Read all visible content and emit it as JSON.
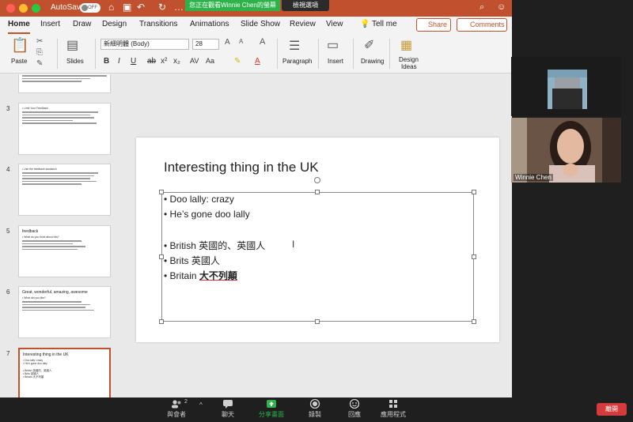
{
  "window": {
    "autosave_label": "AutoSave",
    "autosave_state": "OFF",
    "share_banner": "您正在觀看Winnie Chen的螢幕",
    "view_options": "檢視選項"
  },
  "ribbon_tabs": [
    "Home",
    "Insert",
    "Draw",
    "Design",
    "Transitions",
    "Animations",
    "Slide Show",
    "Review",
    "View",
    "Tell me"
  ],
  "ribbon_buttons": {
    "share": "Share",
    "comments": "Comments",
    "paste": "Paste",
    "slides": "Slides",
    "font_name": "新細明體 (Body)",
    "font_size": "28",
    "paragraph": "Paragraph",
    "insert": "Insert",
    "drawing": "Drawing",
    "design_ideas_1": "Design",
    "design_ideas_2": "Ideas"
  },
  "accent_color": "#c1502e",
  "thumbnails": [
    {
      "num": "",
      "title": "",
      "text": ""
    },
    {
      "num": "3",
      "title": "",
      "text": "• Limit Your Feedback"
    },
    {
      "num": "4",
      "title": "",
      "text": "• Use the feedback sandwich"
    },
    {
      "num": "5",
      "title": "feedback",
      "text": "• What do you think about this?"
    },
    {
      "num": "6",
      "title": "Great, wonderful, amazing, awesome",
      "text": "• What did you like?"
    },
    {
      "num": "7",
      "title": "Interesting thing in the UK",
      "text": "• Doo lally: crazy\n• He's gone doo lally\n\n• British 英國的、英國人\n• Brits 英國人\n• Britain 大不列顛"
    }
  ],
  "slide": {
    "title": "Interesting thing in the UK",
    "bullets": [
      "• Doo lally: crazy",
      "• He’s gone doo lally",
      "• British 英國的、英國人",
      "• Brits 英國人",
      "• Britain "
    ],
    "bold_text": "大不列顛"
  },
  "participants": {
    "tile2_name": "Winnie Chen"
  },
  "zoom_bar": {
    "participants": "與會者",
    "participants_count": "2",
    "chat": "聊天",
    "share_screen": "分享畫面",
    "record": "錄製",
    "reactions": "回應",
    "apps": "應用程式",
    "leave": "離開"
  }
}
